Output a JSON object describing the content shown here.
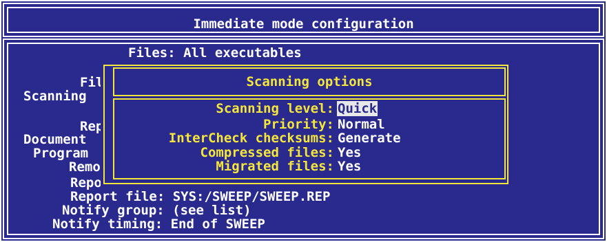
{
  "window": {
    "title": "Immediate mode configuration"
  },
  "background_fields": {
    "files_line": "Files: All executables",
    "left_labels": [
      "Fil",
      "Scanning",
      "Repe",
      "Document",
      "Program",
      "Remov",
      "Repo"
    ],
    "report_file": "Report file: SYS:/SWEEP/SWEEP.REP",
    "notify_group": "Notify group: (see list)",
    "notify_timing": "Notify timing: End of SWEEP"
  },
  "dialog": {
    "title": "Scanning options",
    "options": [
      {
        "label": "Scanning level:",
        "value": "Quick",
        "selected": true
      },
      {
        "label": "Priority:",
        "value": "Normal",
        "selected": false
      },
      {
        "label": "InterCheck checksums:",
        "value": "Generate",
        "selected": false
      },
      {
        "label": "Compressed files:",
        "value": "Yes",
        "selected": false
      },
      {
        "label": "Migrated files:",
        "value": "Yes",
        "selected": false
      }
    ]
  },
  "colors": {
    "background": "#2a2a8e",
    "text": "#ffffff",
    "dialog_accent": "#f5e63c",
    "selection_bg": "#e8e8e8"
  }
}
